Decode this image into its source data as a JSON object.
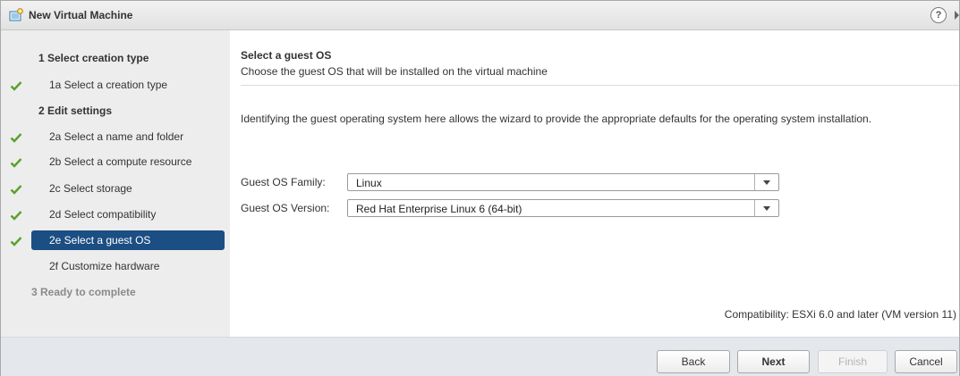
{
  "window": {
    "title": "New Virtual Machine",
    "icon": "new-vm-icon",
    "help_label": "?"
  },
  "sidebar": {
    "steps": [
      {
        "label": "1  Select creation type",
        "type": "group",
        "checked": false
      },
      {
        "label": "1a  Select a creation type",
        "type": "sub",
        "checked": true
      },
      {
        "label": "2  Edit settings",
        "type": "group",
        "checked": false
      },
      {
        "label": "2a  Select a name and folder",
        "type": "sub",
        "checked": true
      },
      {
        "label": "2b  Select a compute resource",
        "type": "sub",
        "checked": true
      },
      {
        "label": "2c  Select storage",
        "type": "sub",
        "checked": true
      },
      {
        "label": "2d  Select compatibility",
        "type": "sub",
        "checked": true
      },
      {
        "label": "2e  Select a guest OS",
        "type": "sub",
        "checked": true,
        "active": true
      },
      {
        "label": "2f  Customize hardware",
        "type": "sub",
        "checked": false
      },
      {
        "label": "3  Ready to complete",
        "type": "group",
        "checked": false,
        "disabled": true
      }
    ]
  },
  "content": {
    "title": "Select a guest OS",
    "description": "Choose the guest OS that will be installed on the virtual machine",
    "intro": "Identifying the guest operating system here allows the wizard to provide the appropriate defaults for the operating system installation.",
    "family_label": "Guest OS Family:",
    "family_value": "Linux",
    "version_label": "Guest OS Version:",
    "version_value": "Red Hat Enterprise Linux 6 (64-bit)",
    "compatibility": "Compatibility: ESXi 6.0 and later (VM version 11)"
  },
  "footer": {
    "back": "Back",
    "next": "Next",
    "finish": "Finish",
    "cancel": "Cancel"
  },
  "colors": {
    "active_step": "#1b4e82",
    "check": "#5aa02c",
    "sidebar_bg": "#ededed",
    "footer_bg": "#e4e8ed"
  }
}
